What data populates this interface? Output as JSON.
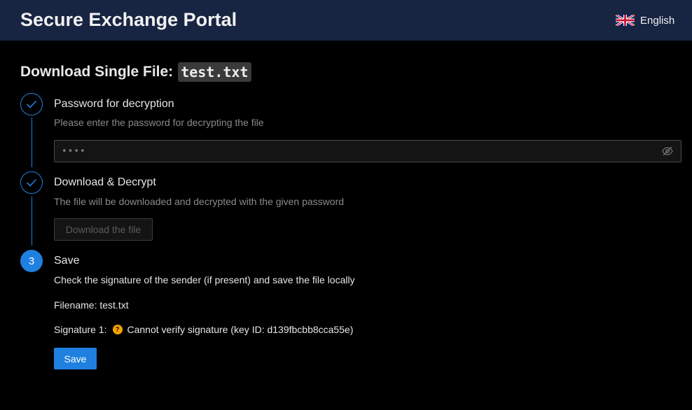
{
  "header": {
    "app_title": "Secure Exchange Portal",
    "language": {
      "label": "English",
      "icon": "uk-flag-icon"
    }
  },
  "page": {
    "heading_prefix": "Download Single File:",
    "filename_chip": "test.txt"
  },
  "steps": [
    {
      "state": "done",
      "title": "Password for decryption",
      "description": "Please enter the password for decrypting the file",
      "password_value": "••••",
      "toggle_icon": "eye-off-icon"
    },
    {
      "state": "done",
      "title": "Download & Decrypt",
      "description": "The file will be downloaded and decrypted with the given password",
      "button_label": "Download the file",
      "button_disabled": true
    },
    {
      "state": "active",
      "number": "3",
      "title": "Save",
      "description": "Check the signature of the sender (if present) and save the file locally",
      "filename_line": "Filename: test.txt",
      "signature_label": "Signature 1:",
      "signature_status_icon": "question-warning-icon",
      "signature_status": "Cannot verify signature (key ID: d139fbcbb8cca55e)",
      "save_label": "Save"
    }
  ],
  "colors": {
    "header_bg": "#172542",
    "accent": "#1f80e0",
    "warning": "#f5a200",
    "page_bg": "#000000"
  }
}
